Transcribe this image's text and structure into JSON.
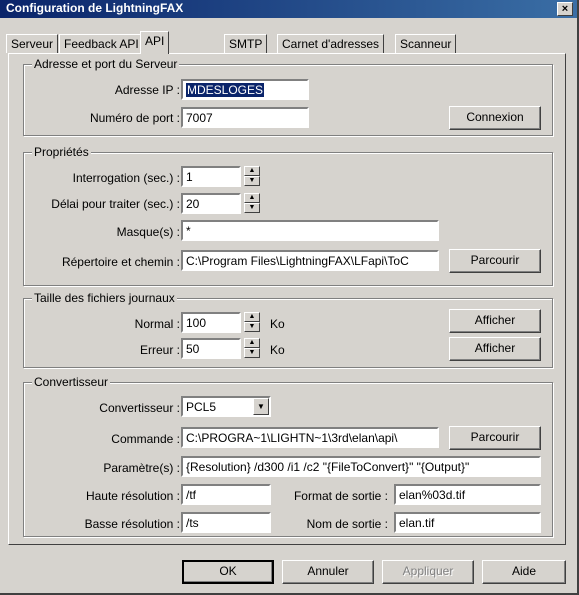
{
  "window": {
    "title": "Configuration de LightningFAX",
    "close_glyph": "×"
  },
  "tabs": [
    "Serveur",
    "Feedback API",
    "API",
    "SMTP",
    "Carnet d'adresses",
    "Scanneur"
  ],
  "server": {
    "group_title": "Adresse et port du Serveur",
    "ip_label": "Adresse IP :",
    "ip_value": "MDESLOGES",
    "port_label": "Numéro de port :",
    "port_value": "7007",
    "connect_button": "Connexion"
  },
  "properties": {
    "group_title": "Propriétés",
    "polling_label": "Interrogation (sec.) :",
    "polling_value": "1",
    "delay_label": "Délai pour traiter (sec.) :",
    "delay_value": "20",
    "mask_label": "Masque(s) :",
    "mask_value": "*",
    "dir_label": "Répertoire et chemin :",
    "dir_value": "C:\\Program Files\\LightningFAX\\LFapi\\ToC",
    "browse_button": "Parcourir"
  },
  "logs": {
    "group_title": "Taille des fichiers journaux",
    "normal_label": "Normal :",
    "normal_value": "100",
    "normal_unit": "Ko",
    "error_label": "Erreur :",
    "error_value": "50",
    "error_unit": "Ko",
    "show_button": "Afficher",
    "show_button_2": "Afficher"
  },
  "converter": {
    "group_title": "Convertisseur",
    "converter_label": "Convertisseur :",
    "converter_value": "PCL5",
    "command_label": "Commande :",
    "command_value": "C:\\PROGRA~1\\LIGHTN~1\\3rd\\elan\\api\\",
    "browse_button": "Parcourir",
    "params_label": "Paramètre(s) :",
    "params_value": "{Resolution} /d300 /i1 /c2 \"{FileToConvert}\" \"{Output}\"",
    "high_res_label": "Haute résolution :",
    "high_res_value": "/tf",
    "low_res_label": "Basse résolution :",
    "low_res_value": "/ts",
    "out_format_label": "Format de sortie :",
    "out_format_value": "elan%03d.tif",
    "out_name_label": "Nom de sortie :",
    "out_name_value": "elan.tif"
  },
  "footer": {
    "ok": "OK",
    "cancel": "Annuler",
    "apply": "Appliquer",
    "help": "Aide"
  },
  "icons": {
    "spin_up": "▲",
    "spin_down": "▼",
    "combo_down": "▼"
  }
}
